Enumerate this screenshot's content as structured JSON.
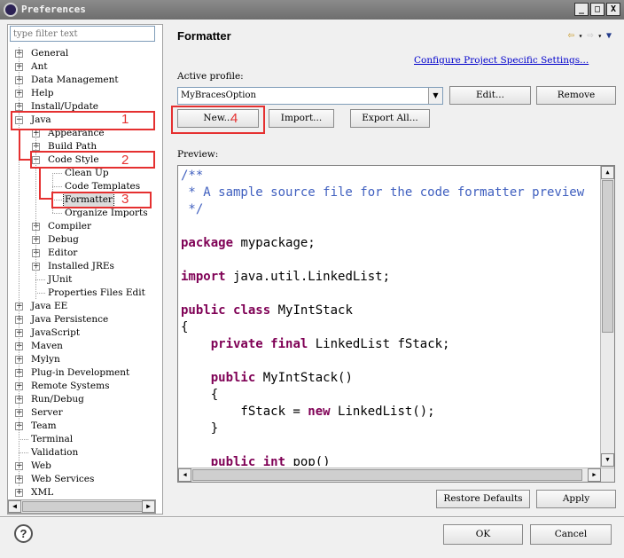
{
  "window": {
    "title": "Preferences",
    "controls": [
      "_",
      "□",
      "X"
    ]
  },
  "left": {
    "filter_placeholder": "type filter text",
    "tree": [
      {
        "label": "General",
        "expander": "+"
      },
      {
        "label": "Ant",
        "expander": "+"
      },
      {
        "label": "Data Management",
        "expander": "+"
      },
      {
        "label": "Help",
        "expander": "+"
      },
      {
        "label": "Install/Update",
        "expander": "+"
      },
      {
        "label": "Java",
        "expander": "-"
      },
      {
        "label": "Appearance",
        "expander": "+"
      },
      {
        "label": "Build Path",
        "expander": "+"
      },
      {
        "label": "Code Style",
        "expander": "-"
      },
      {
        "label": "Clean Up",
        "expander": ""
      },
      {
        "label": "Code Templates",
        "expander": ""
      },
      {
        "label": "Formatter",
        "expander": ""
      },
      {
        "label": "Organize Imports",
        "expander": ""
      },
      {
        "label": "Compiler",
        "expander": "+"
      },
      {
        "label": "Debug",
        "expander": "+"
      },
      {
        "label": "Editor",
        "expander": "+"
      },
      {
        "label": "Installed JREs",
        "expander": "+"
      },
      {
        "label": "JUnit",
        "expander": ""
      },
      {
        "label": "Properties Files Edit",
        "expander": ""
      },
      {
        "label": "Java EE",
        "expander": "+"
      },
      {
        "label": "Java Persistence",
        "expander": "+"
      },
      {
        "label": "JavaScript",
        "expander": "+"
      },
      {
        "label": "Maven",
        "expander": "+"
      },
      {
        "label": "Mylyn",
        "expander": "+"
      },
      {
        "label": "Plug-in Development",
        "expander": "+"
      },
      {
        "label": "Remote Systems",
        "expander": "+"
      },
      {
        "label": "Run/Debug",
        "expander": "+"
      },
      {
        "label": "Server",
        "expander": "+"
      },
      {
        "label": "Team",
        "expander": "+"
      },
      {
        "label": "Terminal",
        "expander": ""
      },
      {
        "label": "Validation",
        "expander": ""
      },
      {
        "label": "Web",
        "expander": "+"
      },
      {
        "label": "Web Services",
        "expander": "+"
      },
      {
        "label": "XML",
        "expander": "+"
      }
    ]
  },
  "main": {
    "title": "Formatter",
    "configure_link": "Configure Project Specific Settings...",
    "active_profile_label": "Active profile:",
    "profile_value": "MyBracesOption",
    "edit_button": "Edit...",
    "remove_button": "Remove",
    "new_button": "New...",
    "import_button": "Import...",
    "export_button": "Export All...",
    "preview_label": "Preview:",
    "restore_button": "Restore Defaults",
    "apply_button": "Apply"
  },
  "code": [
    [
      {
        "t": "/**",
        "c": "cm"
      }
    ],
    [
      {
        "t": " * A sample source file for the code formatter preview",
        "c": "cm"
      }
    ],
    [
      {
        "t": " */",
        "c": "cm"
      }
    ],
    [],
    [
      {
        "t": "package",
        "c": "kw"
      },
      {
        "t": " mypackage;",
        "c": ""
      }
    ],
    [],
    [
      {
        "t": "import",
        "c": "kw"
      },
      {
        "t": " java.util.LinkedList;",
        "c": ""
      }
    ],
    [],
    [
      {
        "t": "public",
        "c": "kw"
      },
      {
        "t": " ",
        "c": ""
      },
      {
        "t": "class",
        "c": "kw"
      },
      {
        "t": " MyIntStack",
        "c": ""
      }
    ],
    [
      {
        "t": "{",
        "c": ""
      }
    ],
    [
      {
        "t": "    ",
        "c": ""
      },
      {
        "t": "private",
        "c": "kw"
      },
      {
        "t": " ",
        "c": ""
      },
      {
        "t": "final",
        "c": "kw"
      },
      {
        "t": " LinkedList fStack;",
        "c": ""
      }
    ],
    [],
    [
      {
        "t": "    ",
        "c": ""
      },
      {
        "t": "public",
        "c": "kw"
      },
      {
        "t": " MyIntStack()",
        "c": ""
      }
    ],
    [
      {
        "t": "    {",
        "c": ""
      }
    ],
    [
      {
        "t": "        fStack = ",
        "c": ""
      },
      {
        "t": "new",
        "c": "kw"
      },
      {
        "t": " LinkedList();",
        "c": ""
      }
    ],
    [
      {
        "t": "    }",
        "c": ""
      }
    ],
    [],
    [
      {
        "t": "    ",
        "c": ""
      },
      {
        "t": "public",
        "c": "kw"
      },
      {
        "t": " ",
        "c": ""
      },
      {
        "t": "int",
        "c": "kw"
      },
      {
        "t": " pop()",
        "c": ""
      }
    ]
  ],
  "annotations": [
    "1",
    "2",
    "3",
    "4"
  ],
  "footer": {
    "help_icon": "?",
    "ok_button": "OK",
    "cancel_button": "Cancel"
  }
}
